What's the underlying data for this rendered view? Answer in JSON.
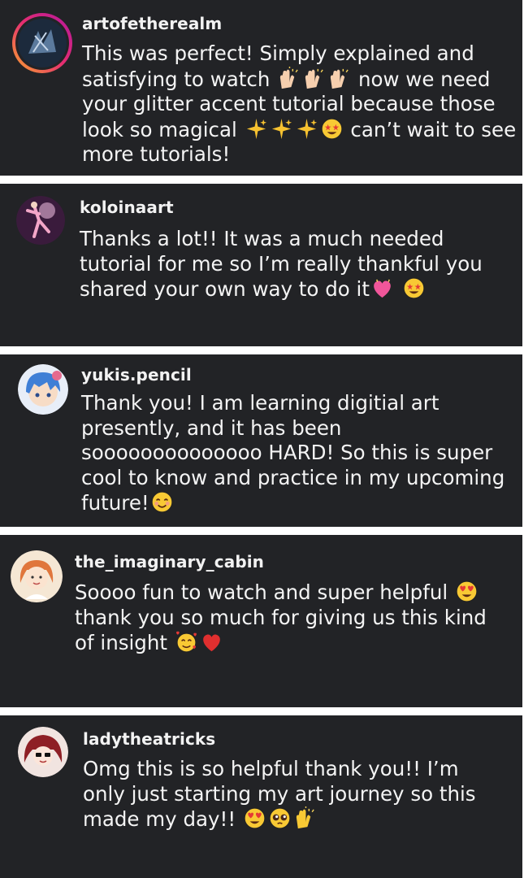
{
  "comments": [
    {
      "username": "artofetherealm",
      "parts": [
        "This was perfect! Simply explained and satisfying to watch ",
        " now we need your glitter accent tutorial because those look so magical ",
        " can’t wait to see more tutorials!"
      ],
      "emojis": [
        "raising-hands",
        "sparkles",
        "star-struck"
      ]
    },
    {
      "username": "koloinaart",
      "parts": [
        "Thanks a lot!! It was a much needed tutorial for me so I’m really thankful you shared your own way to do it"
      ],
      "emojis": [
        "sparkling-heart",
        "star-struck"
      ]
    },
    {
      "username": "yukis.pencil",
      "parts": [
        "Thank you! I am learning digitial art presently, and it has been soooooooooooooo HARD! So this is super cool to know and practice in my upcoming future!"
      ],
      "emojis": [
        "smiling-face"
      ]
    },
    {
      "username": "the_imaginary_cabin",
      "parts": [
        "Soooo fun to watch and super helpful ",
        " thank you so much for giving us this kind of insight "
      ],
      "emojis": [
        "heart-eyes",
        "smiling-face-with-hearts",
        "red-heart"
      ]
    },
    {
      "username": "ladytheatricks",
      "parts": [
        "Omg this is so helpful thank you!! I’m only just starting my art journey so this made my day!! "
      ],
      "emojis": [
        "heart-eyes",
        "pleading-face",
        "raising-hands"
      ]
    }
  ]
}
